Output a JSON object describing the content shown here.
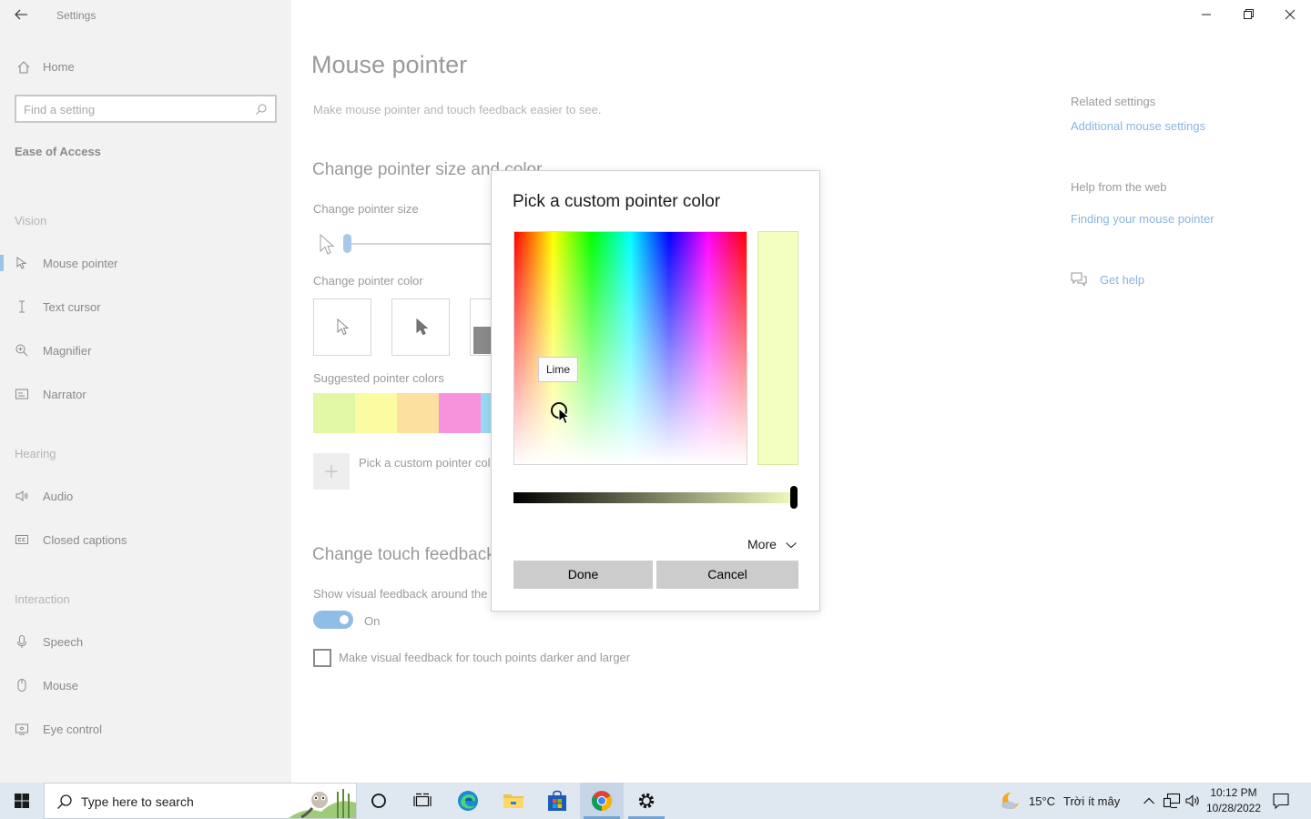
{
  "window": {
    "app_title": "Settings"
  },
  "sidebar": {
    "home_label": "Home",
    "search_placeholder": "Find a setting",
    "category": "Ease of Access",
    "sections": [
      {
        "heading": "Vision",
        "items": [
          "Mouse pointer",
          "Text cursor",
          "Magnifier",
          "Narrator"
        ]
      },
      {
        "heading": "Hearing",
        "items": [
          "Audio",
          "Closed captions"
        ]
      },
      {
        "heading": "Interaction",
        "items": [
          "Speech",
          "Mouse",
          "Eye control"
        ]
      }
    ],
    "active_item": "Mouse pointer"
  },
  "main": {
    "title": "Mouse pointer",
    "description": "Make mouse pointer and touch feedback easier to see.",
    "size_color_heading": "Change pointer size and color",
    "pointer_size_label": "Change pointer size",
    "pointer_size_value_fraction": 0.0,
    "pointer_color_label": "Change pointer color",
    "suggested_label": "Suggested pointer colors",
    "suggested_colors": [
      "#e1f7a6",
      "#fbfba2",
      "#fbe0a0",
      "#f792dd",
      "#9bd9f4"
    ],
    "custom_color_label": "Pick a custom pointer color",
    "touch_heading": "Change touch feedback",
    "touch_show_label": "Show visual feedback around the touch points when I touch the screen",
    "touch_toggle_state": "On",
    "touch_darker_label": "Make visual feedback for touch points darker and larger",
    "touch_darker_checked": false
  },
  "right": {
    "related_heading": "Related settings",
    "related_link": "Additional mouse settings",
    "help_heading": "Help from the web",
    "help_link": "Finding your mouse pointer",
    "get_help": "Get help"
  },
  "dialog": {
    "title": "Pick a custom pointer color",
    "tooltip": "Lime",
    "selected_color": "#f2ffc0",
    "brightness_fraction": 1.0,
    "more_label": "More",
    "done_label": "Done",
    "cancel_label": "Cancel"
  },
  "taskbar": {
    "search_text": "Type here to search",
    "weather": "15°C",
    "weather_desc": "Trời ít mây",
    "time": "10:12 PM",
    "date": "10/28/2022",
    "pinned": [
      "cortana-icon",
      "task-view-icon",
      "edge-icon",
      "file-explorer-icon",
      "store-icon",
      "chrome-icon",
      "settings-icon"
    ]
  }
}
